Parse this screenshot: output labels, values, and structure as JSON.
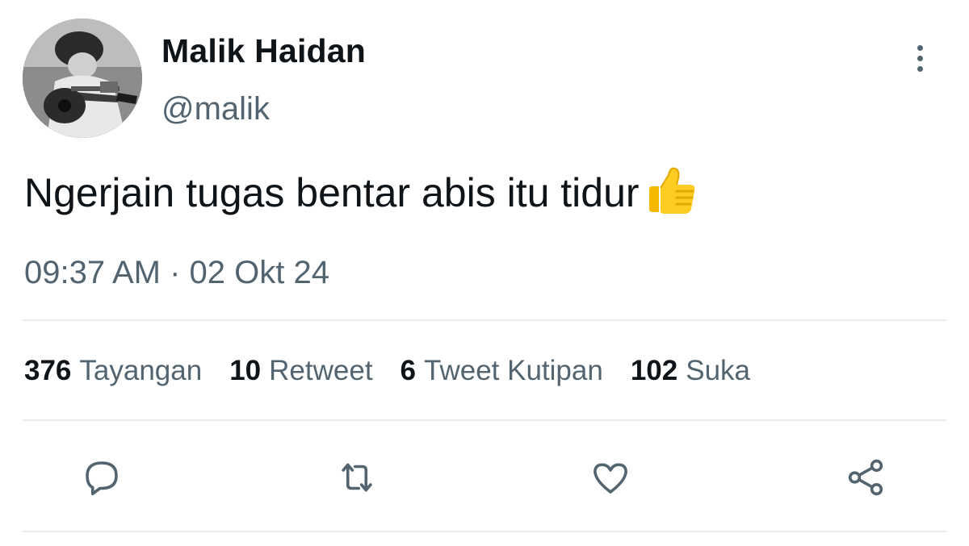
{
  "tweet": {
    "display_name": "Malik Haidan",
    "handle": "@malik",
    "text": "Ngerjain tugas bentar abis itu tidur",
    "emoji": "thumbs-up-emoji",
    "timestamp": "09:37 AM · 02 Okt 24"
  },
  "stats": [
    {
      "count": "376",
      "label": "Tayangan"
    },
    {
      "count": "10",
      "label": "Retweet"
    },
    {
      "count": "6",
      "label": "Tweet Kutipan"
    },
    {
      "count": "102",
      "label": "Suka"
    }
  ],
  "actions": {
    "reply_icon": "reply-icon",
    "retweet_icon": "retweet-icon",
    "like_icon": "heart-icon",
    "share_icon": "share-icon",
    "more_icon": "more-vertical-icon"
  },
  "colors": {
    "primary_text": "#0f1419",
    "secondary_text": "#536471",
    "divider": "#e6ecf0",
    "icon": "#536471"
  }
}
